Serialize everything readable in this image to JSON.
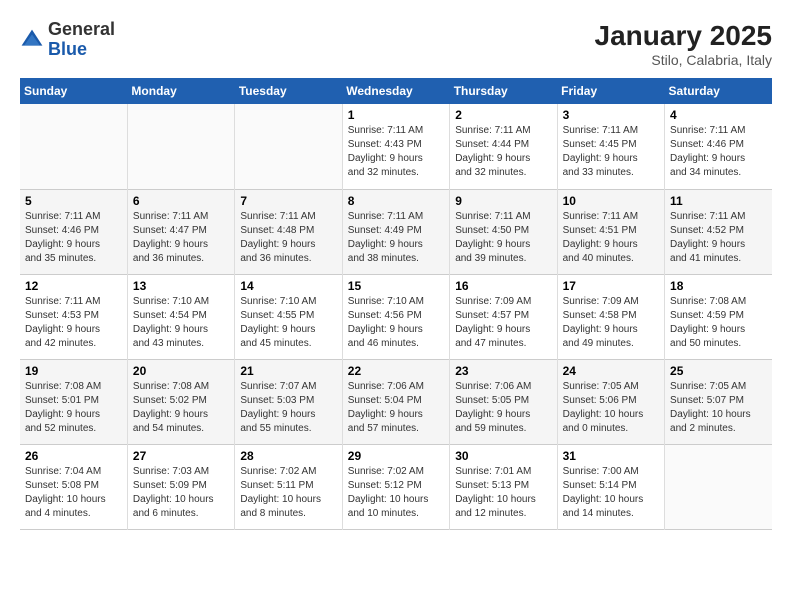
{
  "header": {
    "logo_general": "General",
    "logo_blue": "Blue",
    "month": "January 2025",
    "location": "Stilo, Calabria, Italy"
  },
  "weekdays": [
    "Sunday",
    "Monday",
    "Tuesday",
    "Wednesday",
    "Thursday",
    "Friday",
    "Saturday"
  ],
  "weeks": [
    [
      {
        "day": "",
        "info": ""
      },
      {
        "day": "",
        "info": ""
      },
      {
        "day": "",
        "info": ""
      },
      {
        "day": "1",
        "info": "Sunrise: 7:11 AM\nSunset: 4:43 PM\nDaylight: 9 hours\nand 32 minutes."
      },
      {
        "day": "2",
        "info": "Sunrise: 7:11 AM\nSunset: 4:44 PM\nDaylight: 9 hours\nand 32 minutes."
      },
      {
        "day": "3",
        "info": "Sunrise: 7:11 AM\nSunset: 4:45 PM\nDaylight: 9 hours\nand 33 minutes."
      },
      {
        "day": "4",
        "info": "Sunrise: 7:11 AM\nSunset: 4:46 PM\nDaylight: 9 hours\nand 34 minutes."
      }
    ],
    [
      {
        "day": "5",
        "info": "Sunrise: 7:11 AM\nSunset: 4:46 PM\nDaylight: 9 hours\nand 35 minutes."
      },
      {
        "day": "6",
        "info": "Sunrise: 7:11 AM\nSunset: 4:47 PM\nDaylight: 9 hours\nand 36 minutes."
      },
      {
        "day": "7",
        "info": "Sunrise: 7:11 AM\nSunset: 4:48 PM\nDaylight: 9 hours\nand 36 minutes."
      },
      {
        "day": "8",
        "info": "Sunrise: 7:11 AM\nSunset: 4:49 PM\nDaylight: 9 hours\nand 38 minutes."
      },
      {
        "day": "9",
        "info": "Sunrise: 7:11 AM\nSunset: 4:50 PM\nDaylight: 9 hours\nand 39 minutes."
      },
      {
        "day": "10",
        "info": "Sunrise: 7:11 AM\nSunset: 4:51 PM\nDaylight: 9 hours\nand 40 minutes."
      },
      {
        "day": "11",
        "info": "Sunrise: 7:11 AM\nSunset: 4:52 PM\nDaylight: 9 hours\nand 41 minutes."
      }
    ],
    [
      {
        "day": "12",
        "info": "Sunrise: 7:11 AM\nSunset: 4:53 PM\nDaylight: 9 hours\nand 42 minutes."
      },
      {
        "day": "13",
        "info": "Sunrise: 7:10 AM\nSunset: 4:54 PM\nDaylight: 9 hours\nand 43 minutes."
      },
      {
        "day": "14",
        "info": "Sunrise: 7:10 AM\nSunset: 4:55 PM\nDaylight: 9 hours\nand 45 minutes."
      },
      {
        "day": "15",
        "info": "Sunrise: 7:10 AM\nSunset: 4:56 PM\nDaylight: 9 hours\nand 46 minutes."
      },
      {
        "day": "16",
        "info": "Sunrise: 7:09 AM\nSunset: 4:57 PM\nDaylight: 9 hours\nand 47 minutes."
      },
      {
        "day": "17",
        "info": "Sunrise: 7:09 AM\nSunset: 4:58 PM\nDaylight: 9 hours\nand 49 minutes."
      },
      {
        "day": "18",
        "info": "Sunrise: 7:08 AM\nSunset: 4:59 PM\nDaylight: 9 hours\nand 50 minutes."
      }
    ],
    [
      {
        "day": "19",
        "info": "Sunrise: 7:08 AM\nSunset: 5:01 PM\nDaylight: 9 hours\nand 52 minutes."
      },
      {
        "day": "20",
        "info": "Sunrise: 7:08 AM\nSunset: 5:02 PM\nDaylight: 9 hours\nand 54 minutes."
      },
      {
        "day": "21",
        "info": "Sunrise: 7:07 AM\nSunset: 5:03 PM\nDaylight: 9 hours\nand 55 minutes."
      },
      {
        "day": "22",
        "info": "Sunrise: 7:06 AM\nSunset: 5:04 PM\nDaylight: 9 hours\nand 57 minutes."
      },
      {
        "day": "23",
        "info": "Sunrise: 7:06 AM\nSunset: 5:05 PM\nDaylight: 9 hours\nand 59 minutes."
      },
      {
        "day": "24",
        "info": "Sunrise: 7:05 AM\nSunset: 5:06 PM\nDaylight: 10 hours\nand 0 minutes."
      },
      {
        "day": "25",
        "info": "Sunrise: 7:05 AM\nSunset: 5:07 PM\nDaylight: 10 hours\nand 2 minutes."
      }
    ],
    [
      {
        "day": "26",
        "info": "Sunrise: 7:04 AM\nSunset: 5:08 PM\nDaylight: 10 hours\nand 4 minutes."
      },
      {
        "day": "27",
        "info": "Sunrise: 7:03 AM\nSunset: 5:09 PM\nDaylight: 10 hours\nand 6 minutes."
      },
      {
        "day": "28",
        "info": "Sunrise: 7:02 AM\nSunset: 5:11 PM\nDaylight: 10 hours\nand 8 minutes."
      },
      {
        "day": "29",
        "info": "Sunrise: 7:02 AM\nSunset: 5:12 PM\nDaylight: 10 hours\nand 10 minutes."
      },
      {
        "day": "30",
        "info": "Sunrise: 7:01 AM\nSunset: 5:13 PM\nDaylight: 10 hours\nand 12 minutes."
      },
      {
        "day": "31",
        "info": "Sunrise: 7:00 AM\nSunset: 5:14 PM\nDaylight: 10 hours\nand 14 minutes."
      },
      {
        "day": "",
        "info": ""
      }
    ]
  ]
}
